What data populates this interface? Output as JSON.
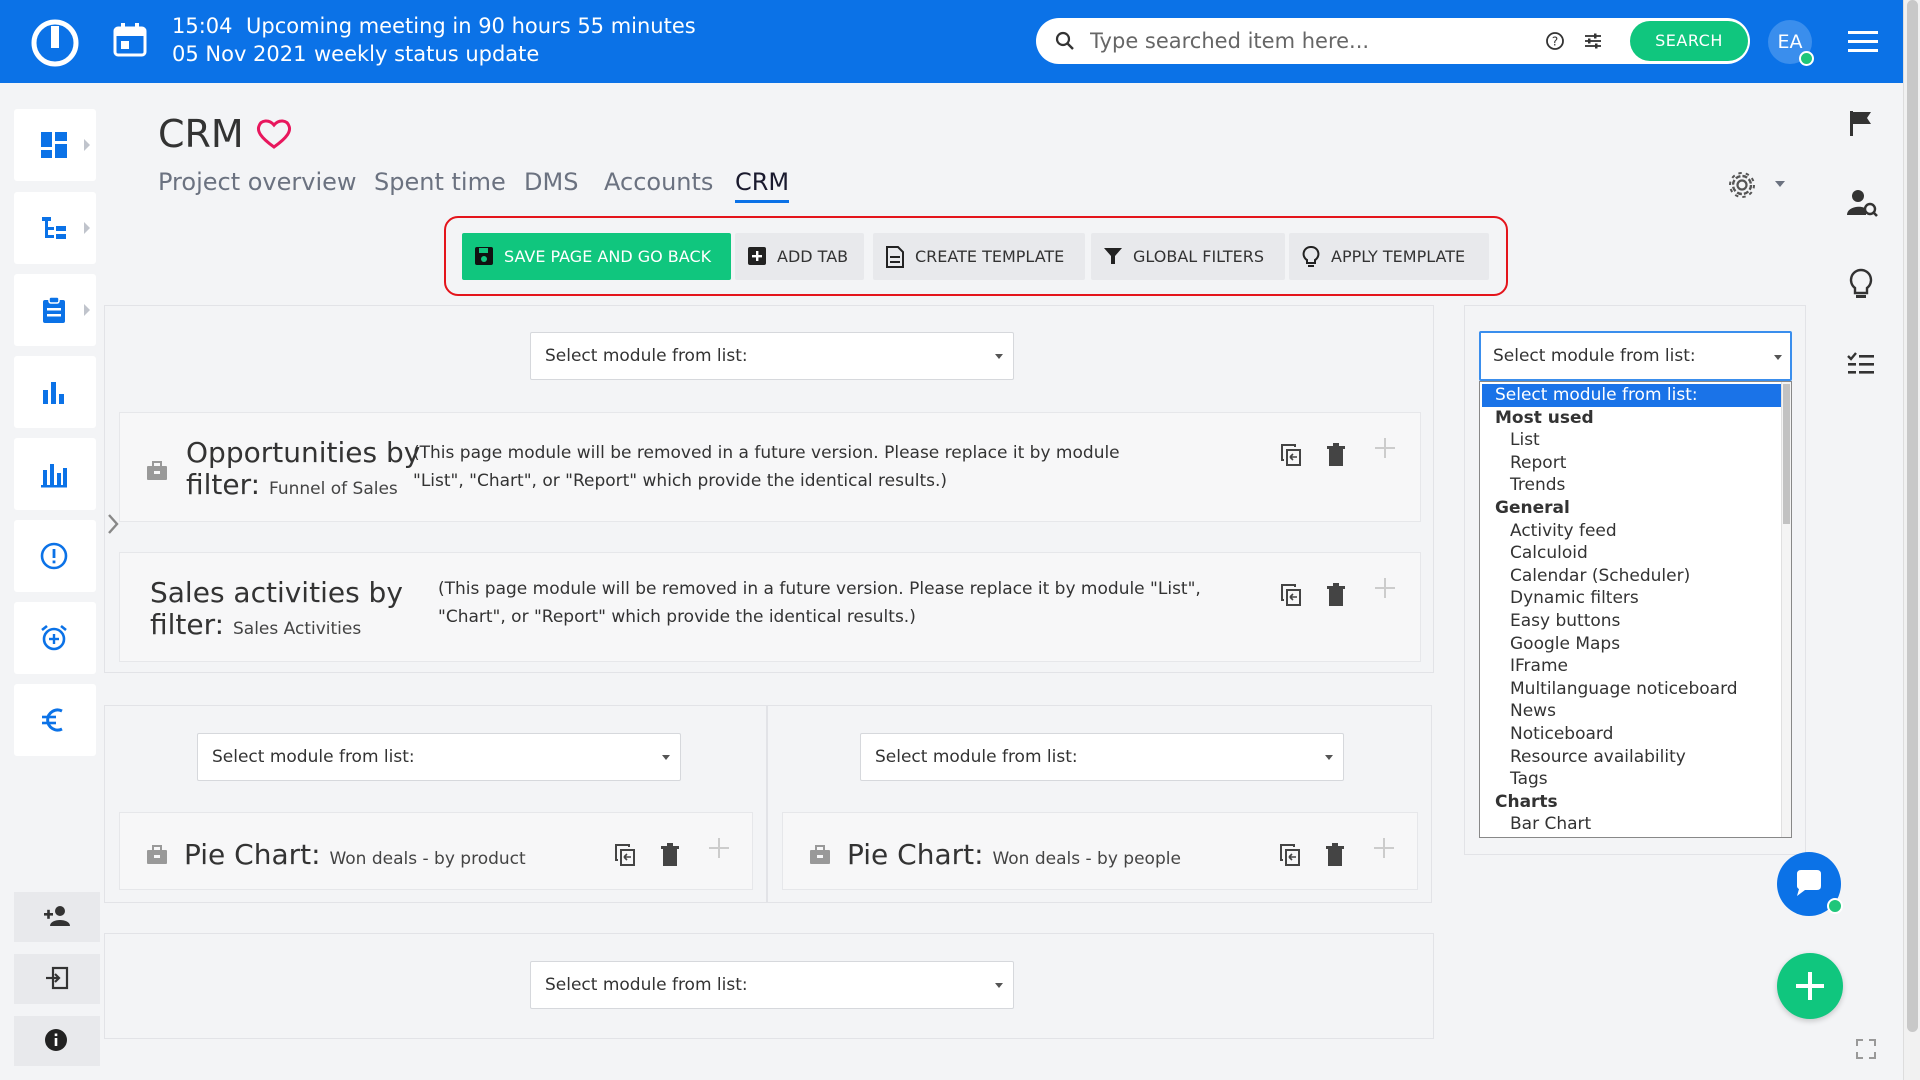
{
  "topbar": {
    "time": "15:04",
    "meeting_text": "Upcoming meeting in 90 hours 55 minutes",
    "date": "05 Nov 2021",
    "meeting_title": "weekly status update",
    "search_placeholder": "Type searched item here...",
    "search_button": "SEARCH",
    "avatar_initials": "EA"
  },
  "page": {
    "title": "CRM",
    "tabs": [
      {
        "label": "Project overview"
      },
      {
        "label": "Spent time"
      },
      {
        "label": "DMS"
      },
      {
        "label": "Accounts"
      },
      {
        "label": "CRM"
      }
    ],
    "active_tab": "CRM"
  },
  "toolbar": {
    "save_label": "SAVE PAGE AND GO BACK",
    "add_tab_label": "ADD TAB",
    "create_template_label": "CREATE TEMPLATE",
    "global_filters_label": "GLOBAL FILTERS",
    "apply_template_label": "APPLY TEMPLATE"
  },
  "select_placeholder": "Select module from list:",
  "modules": {
    "opportunities": {
      "title": "Opportunities by filter:",
      "subtitle": "Funnel of Sales",
      "note": "(This page module will be removed in a future version. Please replace it by module \"List\", \"Chart\", or \"Report\" which provide the identical results.)"
    },
    "sales": {
      "title": "Sales activities by filter:",
      "subtitle": "Sales Activities",
      "note": "(This page module will be removed in a future version. Please replace it by module \"List\", \"Chart\", or \"Report\" which provide the identical results.)"
    },
    "pie_product": {
      "title": "Pie Chart:",
      "subtitle": "Won deals - by product"
    },
    "pie_people": {
      "title": "Pie Chart:",
      "subtitle": "Won deals - by people"
    }
  },
  "dropdown": {
    "selected": "Select module from list:",
    "options": [
      {
        "label": "Select module from list:",
        "kind": "selected"
      },
      {
        "label": "Most used",
        "kind": "group"
      },
      {
        "label": "List",
        "kind": "item"
      },
      {
        "label": "Report",
        "kind": "item"
      },
      {
        "label": "Trends",
        "kind": "item"
      },
      {
        "label": "General",
        "kind": "group"
      },
      {
        "label": "Activity feed",
        "kind": "item"
      },
      {
        "label": "Calculoid",
        "kind": "item"
      },
      {
        "label": "Calendar (Scheduler)",
        "kind": "item"
      },
      {
        "label": "Dynamic filters",
        "kind": "item"
      },
      {
        "label": "Easy buttons",
        "kind": "item"
      },
      {
        "label": "Google Maps",
        "kind": "item"
      },
      {
        "label": "IFrame",
        "kind": "item"
      },
      {
        "label": "Multilanguage noticeboard",
        "kind": "item"
      },
      {
        "label": "News",
        "kind": "item"
      },
      {
        "label": "Noticeboard",
        "kind": "item"
      },
      {
        "label": "Resource availability",
        "kind": "item"
      },
      {
        "label": "Tags",
        "kind": "item"
      },
      {
        "label": "Charts",
        "kind": "group"
      },
      {
        "label": "Bar Chart",
        "kind": "item"
      }
    ]
  },
  "colors": {
    "brand_blue": "#0b72e7",
    "accent_green": "#10c67e",
    "highlight_red": "#e4141b"
  }
}
